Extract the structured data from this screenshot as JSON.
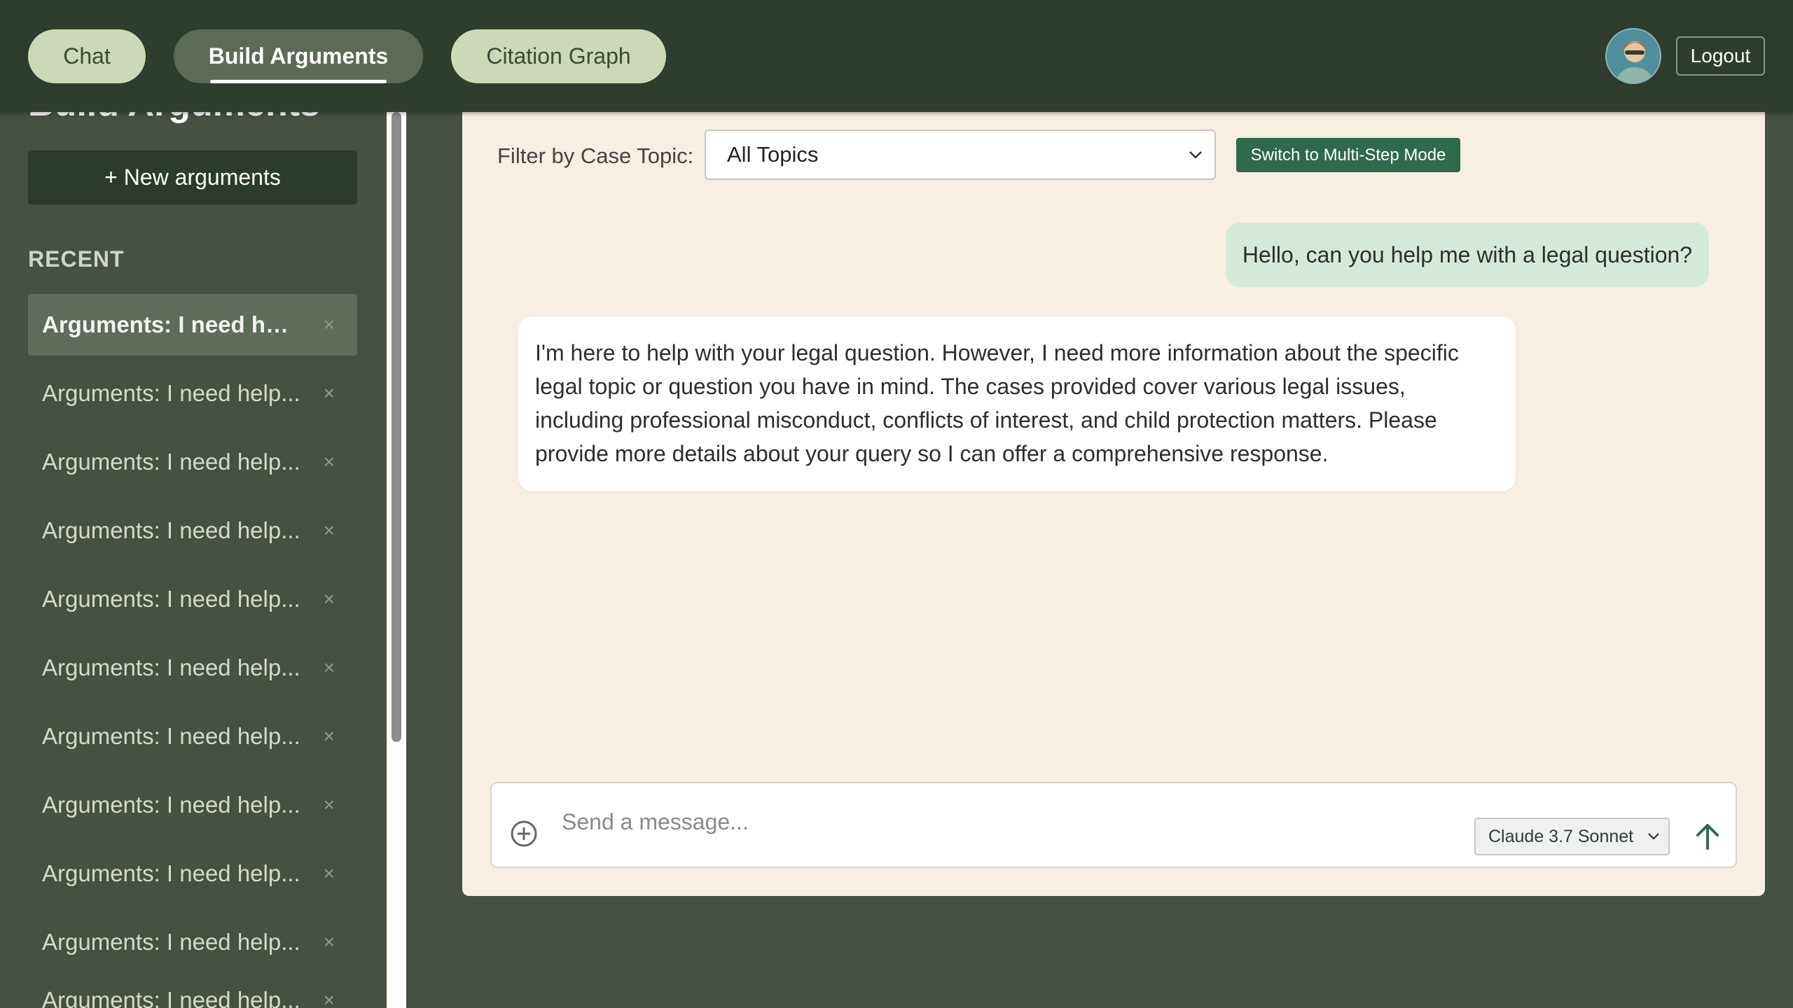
{
  "nav": {
    "tabs": [
      {
        "label": "Chat"
      },
      {
        "label": "Build Arguments"
      },
      {
        "label": "Citation Graph"
      }
    ],
    "logout_label": "Logout"
  },
  "sidebar": {
    "title": "Build Arguments",
    "new_button_label": "+ New arguments",
    "recent_label": "RECENT",
    "items": [
      {
        "label": "Arguments: I need help..."
      },
      {
        "label": "Arguments: I need help..."
      },
      {
        "label": "Arguments: I need help..."
      },
      {
        "label": "Arguments: I need help..."
      },
      {
        "label": "Arguments: I need help..."
      },
      {
        "label": "Arguments: I need help..."
      },
      {
        "label": "Arguments: I need help..."
      },
      {
        "label": "Arguments: I need help..."
      },
      {
        "label": "Arguments: I need help..."
      },
      {
        "label": "Arguments: I need help..."
      },
      {
        "label": "Arguments: I need help..."
      }
    ],
    "close_glyph": "×"
  },
  "filter": {
    "label": "Filter by Case Topic:",
    "selected": "All Topics"
  },
  "mode_button_label": "Switch to Multi-Step Mode",
  "messages": [
    {
      "role": "user",
      "text": "Hello, can you help me with a legal question?"
    },
    {
      "role": "assistant",
      "text": "I'm here to help with your legal question. However, I need more information about the specific legal topic or question you have in mind. The cases provided cover various legal issues, including professional misconduct, conflicts of interest, and child protection matters. Please provide more details about your query so I can offer a comprehensive response."
    }
  ],
  "composer": {
    "placeholder": "Send a message...",
    "model": "Claude 3.7 Sonnet"
  },
  "colors": {
    "topbar": "#2e3d2d",
    "sidebar": "#465143",
    "panel": "#f7efe3",
    "accent_button": "#2f6a4f",
    "user_bubble": "#d4e9da"
  }
}
